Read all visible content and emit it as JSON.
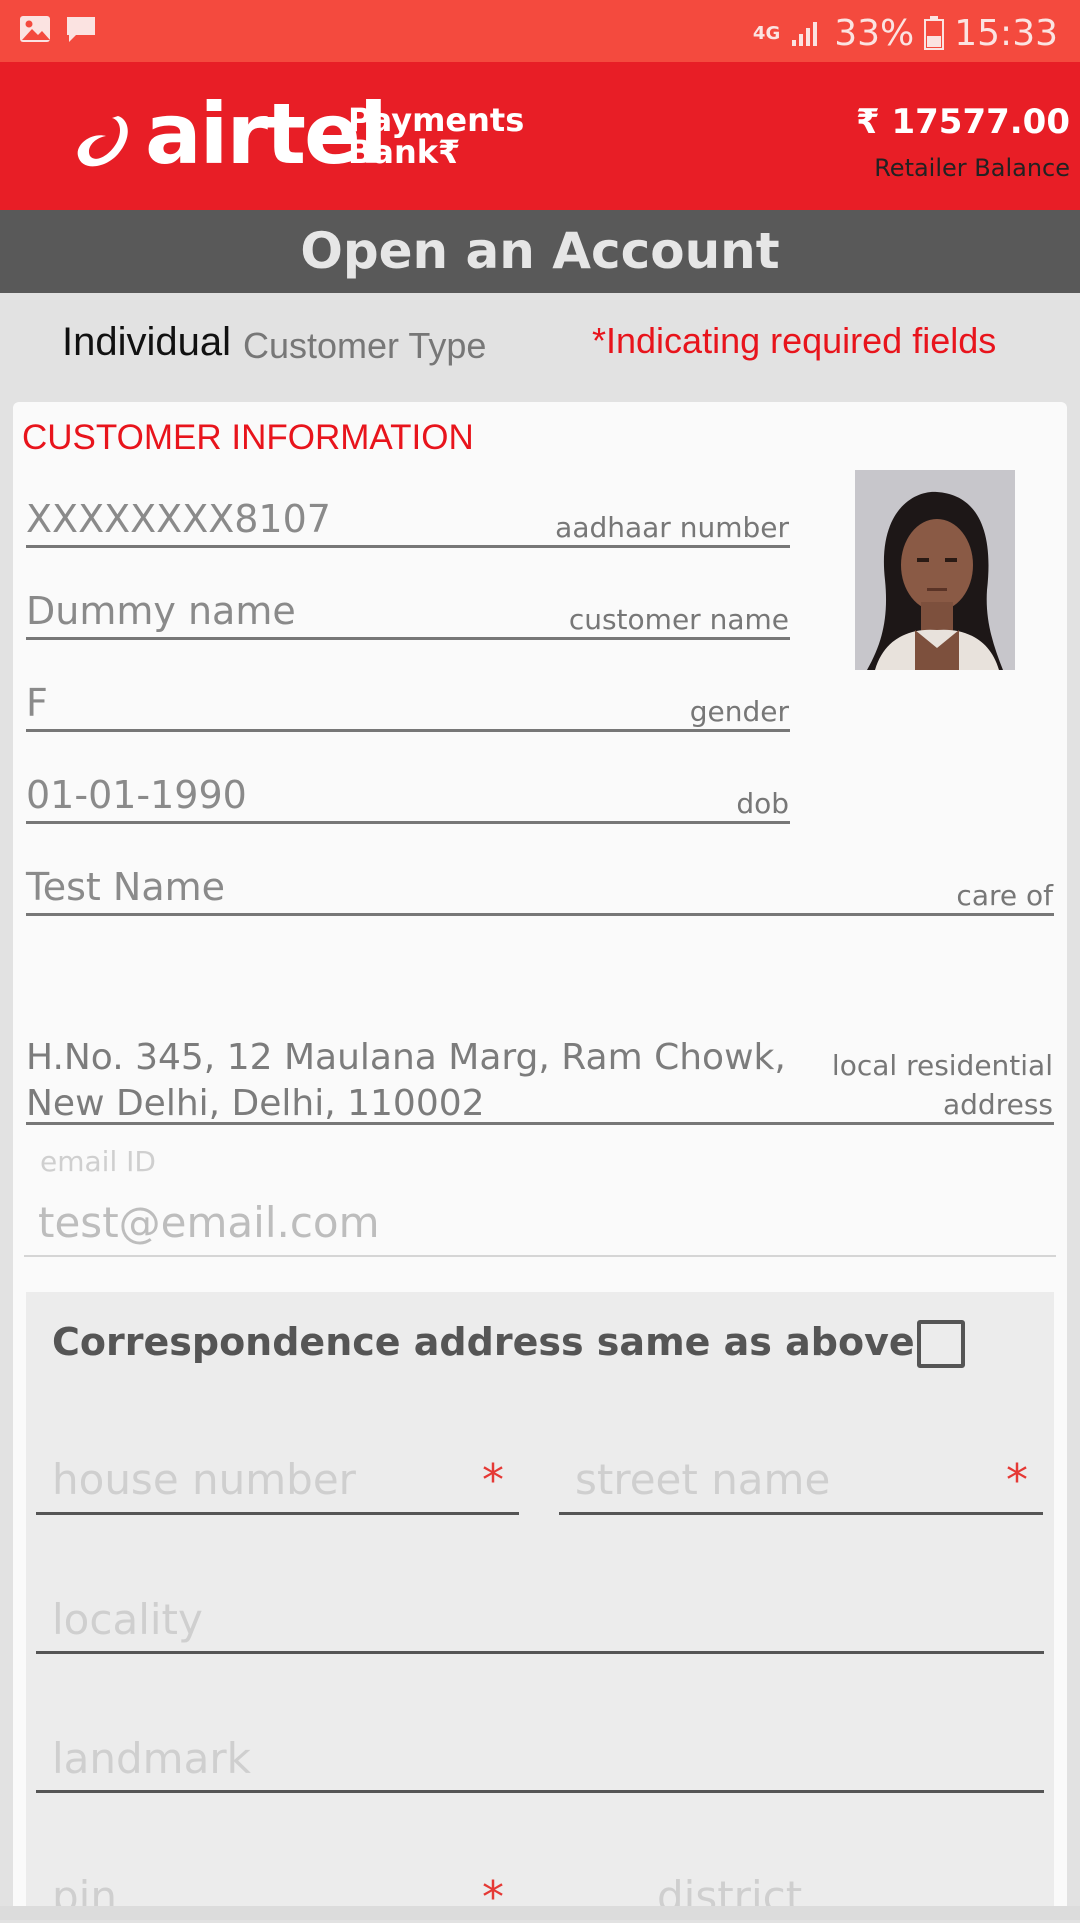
{
  "status_bar": {
    "network": "4G",
    "battery": "33%",
    "time": "15:33"
  },
  "header": {
    "brand": "airtel",
    "brand_sub_line1": "Payments",
    "brand_sub_line2": "Bank₹",
    "balance": "₹ 17577.00",
    "balance_label": "Retailer Balance",
    "accent_color": "#e81e26"
  },
  "page": {
    "title": "Open an Account",
    "customer_type_value": "Individual",
    "customer_type_label": "Customer Type",
    "required_note": "*Indicating required fields"
  },
  "customer_info": {
    "section_title": "CUSTOMER INFORMATION",
    "fields": [
      {
        "value": "XXXXXXXX8107",
        "label": "aadhaar number"
      },
      {
        "value": "Dummy name",
        "label": "customer name"
      },
      {
        "value": "F",
        "label": "gender"
      },
      {
        "value": "01-01-1990",
        "label": "dob"
      },
      {
        "value": "Test Name",
        "label": "care of"
      }
    ],
    "address": {
      "line1": "H.No. 345, 12 Maulana Marg, Ram Chowk,",
      "line2": "New Delhi, Delhi, 110002",
      "label_line1": "local residential",
      "label_line2": "address"
    },
    "email": {
      "label": "email ID",
      "value": "test@email.com"
    }
  },
  "correspondence": {
    "title": "Correspondence address same as above",
    "checked": false,
    "house_number_placeholder": "house number",
    "street_name_placeholder": "street name",
    "locality_placeholder": "locality",
    "landmark_placeholder": "landmark",
    "pin_placeholder": "pin",
    "district_placeholder": "district",
    "required_mark": "*"
  }
}
